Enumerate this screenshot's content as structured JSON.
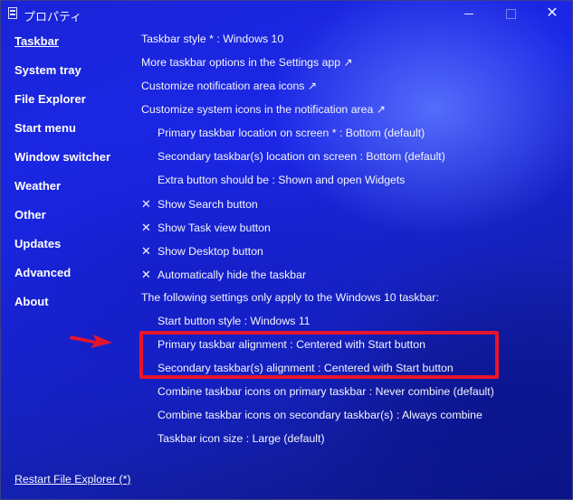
{
  "window": {
    "title": "プロパティ",
    "minimize_glyph": "minimize-icon",
    "maximize_glyph": "maximize-icon",
    "close_glyph": "✕"
  },
  "sidebar": {
    "items": [
      {
        "label": "Taskbar",
        "active": true
      },
      {
        "label": "System tray"
      },
      {
        "label": "File Explorer"
      },
      {
        "label": "Start menu"
      },
      {
        "label": "Window switcher"
      },
      {
        "label": "Weather"
      },
      {
        "label": "Other"
      },
      {
        "label": "Updates"
      },
      {
        "label": "Advanced"
      },
      {
        "label": "About"
      }
    ],
    "restart_link": "Restart File Explorer (*)"
  },
  "settings": {
    "taskbar_style": "Taskbar style * : Windows 10",
    "more_options": "More taskbar options in the Settings app ↗",
    "customize_notification_icons": "Customize notification area icons ↗",
    "customize_system_icons": "Customize system icons in the notification area ↗",
    "primary_location": "Primary taskbar location on screen * : Bottom (default)",
    "secondary_location": "Secondary taskbar(s) location on screen : Bottom (default)",
    "extra_button": "Extra button should be : Shown and open Widgets",
    "check_glyph": "✕",
    "show_search": "Show Search button",
    "show_task_view": "Show Task view button",
    "show_desktop": "Show Desktop button",
    "auto_hide": "Automatically hide the taskbar",
    "win10_note": "The following settings only apply to the Windows 10 taskbar:",
    "start_button_style": "Start button style : Windows 11",
    "primary_alignment": "Primary taskbar alignment : Centered with Start button",
    "secondary_alignment": "Secondary taskbar(s) alignment : Centered with Start button",
    "combine_primary": "Combine taskbar icons on primary taskbar : Never combine (default)",
    "combine_secondary": "Combine taskbar icons on secondary taskbar(s) : Always combine",
    "icon_size": "Taskbar icon size : Large (default)"
  },
  "annotations": {
    "highlight_color": "#e8142b",
    "arrow_color": "#e8142b"
  }
}
